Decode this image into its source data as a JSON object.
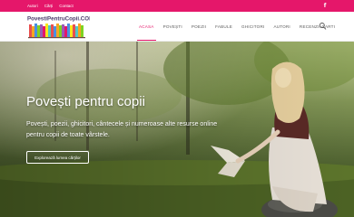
{
  "topbar": {
    "links": [
      "Autori",
      "Cărți",
      "Contact"
    ],
    "facebook_icon": "facebook-icon",
    "background": "#e5176a"
  },
  "header": {
    "logo_text": "PovestiPentruCopii.COM"
  },
  "nav": {
    "items": [
      "Acasa",
      "Povești",
      "Poezii",
      "Fabule",
      "Ghicitori",
      "Autori",
      "Recenzii Carti"
    ],
    "active_index": 0,
    "accent": "#e5176a",
    "search_icon": "search-icon"
  },
  "hero": {
    "title": "Povești pentru copii",
    "description": "Povești, poezii, ghicitori, cântecele și numeroase alte resurse online pentru copii de toate vârstele.",
    "cta_label": "Explorează lumea cărților"
  }
}
